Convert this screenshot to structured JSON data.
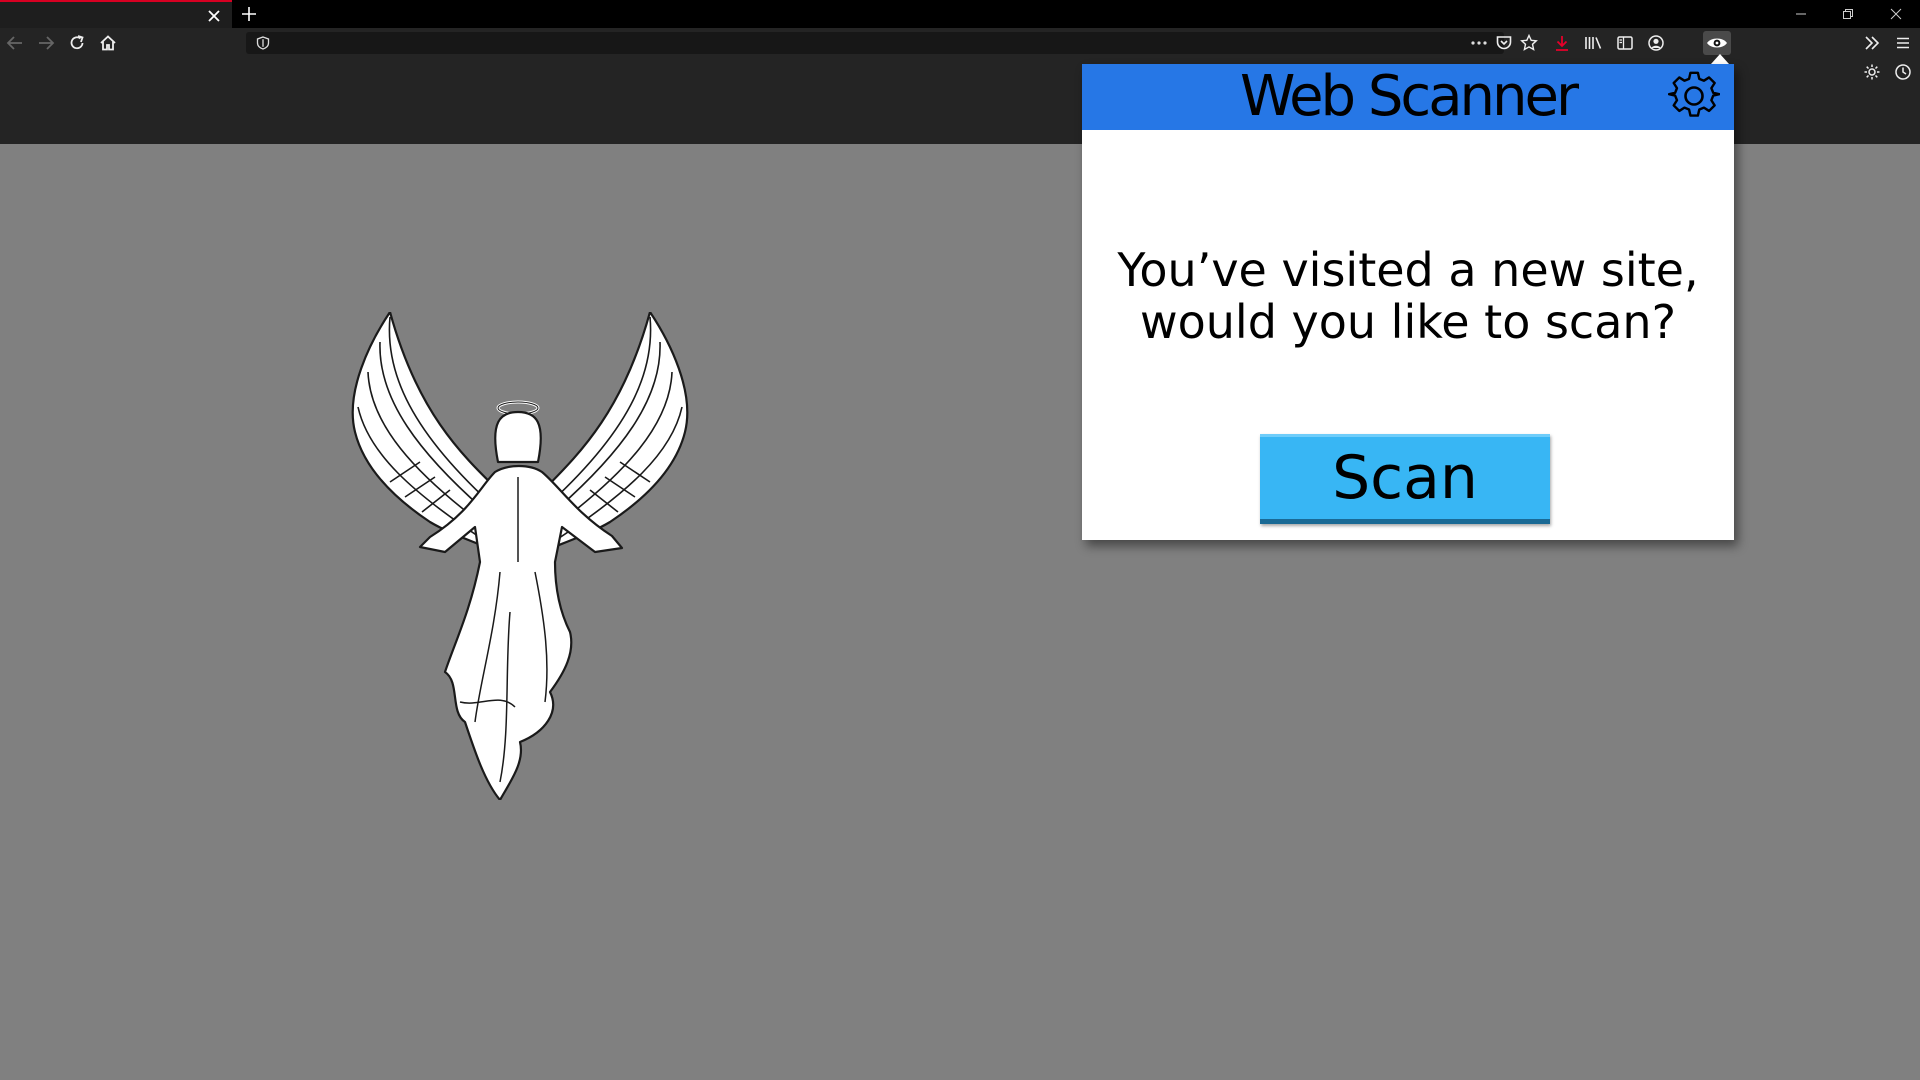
{
  "browser": {
    "tab": {
      "title": ""
    },
    "url": {
      "value": "",
      "placeholder": ""
    },
    "accent_color": "#d70022"
  },
  "icons": {
    "tab_close": "close-icon",
    "new_tab": "plus-icon",
    "back": "arrow-left-icon",
    "forward": "arrow-right-icon",
    "reload": "reload-icon",
    "home": "home-icon",
    "site_info": "shield-icon",
    "page_actions": "more-horizontal-icon",
    "pocket": "pocket-icon",
    "bookmark": "star-icon",
    "downloads": "download-icon",
    "library": "library-icon",
    "sidebar": "sidebar-icon",
    "account": "account-icon",
    "extension": "eye-icon",
    "overflow": "double-chevron-right-icon",
    "menu": "hamburger-menu-icon",
    "settings": "gear-icon",
    "history": "clock-icon"
  },
  "popup": {
    "title": "Web Scanner",
    "message": "You’ve visited a new site, would you like to scan?",
    "button_label": "Scan",
    "header_color": "#2677e6",
    "button_color": "#38b6f4"
  },
  "page": {
    "background_color": "#808080",
    "image": "angel-illustration"
  }
}
